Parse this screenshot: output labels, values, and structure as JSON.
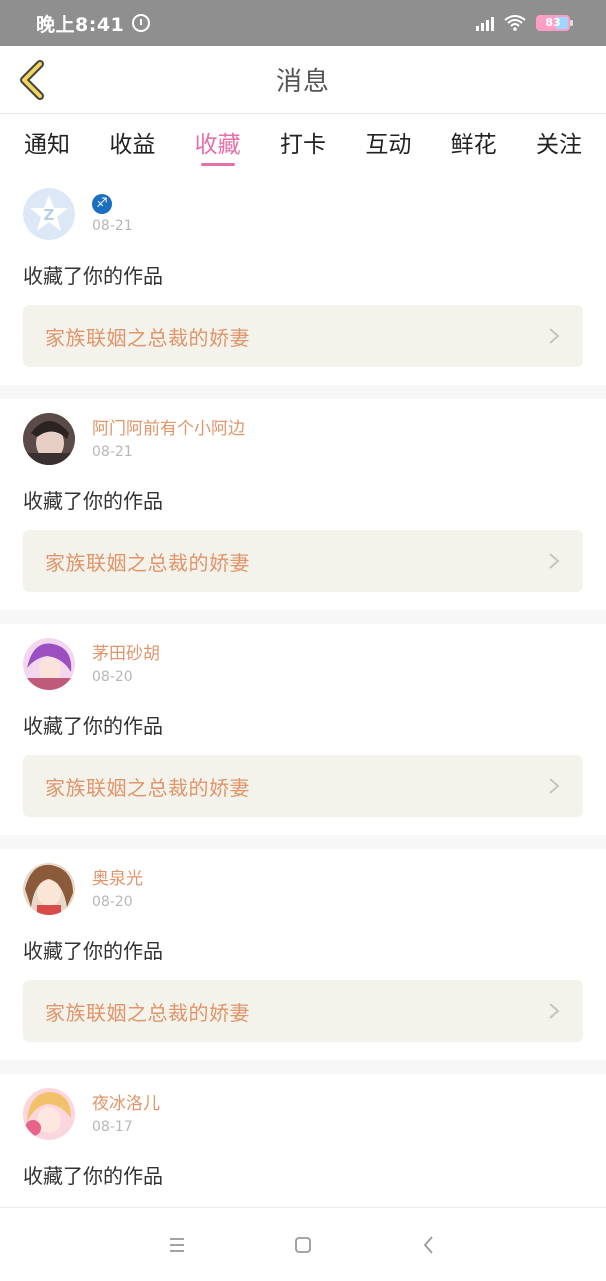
{
  "status_bar": {
    "time": "晚上8:41",
    "battery": "83"
  },
  "header": {
    "title": "消息"
  },
  "tabs": [
    {
      "label": "通知",
      "active": false
    },
    {
      "label": "收益",
      "active": false
    },
    {
      "label": "收藏",
      "active": true
    },
    {
      "label": "打卡",
      "active": false
    },
    {
      "label": "互动",
      "active": false
    },
    {
      "label": "鲜花",
      "active": false
    },
    {
      "label": "关注",
      "active": false
    }
  ],
  "feed": [
    {
      "username": "",
      "zodiac": "♐",
      "date": "08-21",
      "action": "收藏了你的作品",
      "work_title": "家族联姻之总裁的娇妻"
    },
    {
      "username": "阿门阿前有个小阿边",
      "date": "08-21",
      "action": "收藏了你的作品",
      "work_title": "家族联姻之总裁的娇妻"
    },
    {
      "username": "茅田砂胡",
      "date": "08-20",
      "action": "收藏了你的作品",
      "work_title": "家族联姻之总裁的娇妻"
    },
    {
      "username": "奥泉光",
      "date": "08-20",
      "action": "收藏了你的作品",
      "work_title": "家族联姻之总裁的娇妻"
    },
    {
      "username": "夜冰洛儿",
      "date": "08-17",
      "action": "收藏了你的作品",
      "work_title": ""
    }
  ],
  "colors": {
    "accent": "#e56fa8",
    "username": "#e0956a",
    "work_bg": "#f3f3ec"
  }
}
